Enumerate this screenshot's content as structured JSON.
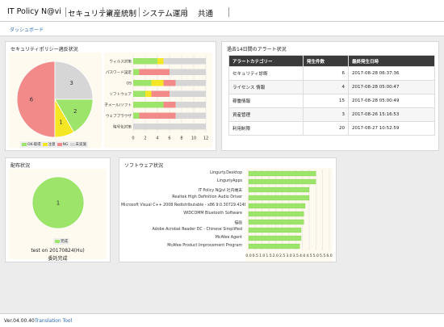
{
  "nav": {
    "items": [
      "IT Policy N@vi",
      "セキュリティ",
      "資産統制",
      "システム運用",
      "共通"
    ]
  },
  "breadcrumb": "ダッシュボード",
  "security_panel": {
    "title": "セキュリティポリシー適反状況",
    "pie_legend": [
      "OK-取得",
      "注意",
      "NG",
      "未実施"
    ]
  },
  "alerts_panel": {
    "title": "過去14日間のアラート状況",
    "columns": [
      "アラートカテゴリー",
      "発生件数",
      "最終発生日時"
    ],
    "rows": [
      [
        "セキュリティ診断",
        "6",
        "2017-08-28 06:37:36"
      ],
      [
        "ライセンス 情報",
        "4",
        "2017-08-28 05:00:47"
      ],
      [
        "稼働情報",
        "15",
        "2017-08-28 05:00:49"
      ],
      [
        "資産管理",
        "3",
        "2017-08-26 15:16:53"
      ],
      [
        "利用制限",
        "20",
        "2017-08-27 10:52:59"
      ]
    ]
  },
  "distribution_panel": {
    "title": "配布状況",
    "legend": "完成",
    "caption_line1": "test on 20170824(Hu)",
    "caption_line2": "委託完成"
  },
  "software_panel": {
    "title": "ソフトウェア状況"
  },
  "colors": {
    "ok_green": "#9de46a",
    "caution_yellow": "#f5e625",
    "ng_red": "#f28a8a",
    "unconducted_gray": "#d6d6d6",
    "link_blue": "#2a6bb5"
  },
  "chart_data": [
    {
      "type": "pie",
      "name": "security-policy-pie",
      "labels": [
        "NG",
        "未実施",
        "OK-取得",
        "注意"
      ],
      "values": [
        6,
        3,
        2,
        1
      ],
      "legend": [
        "OK-取得",
        "注意",
        "NG",
        "未実施"
      ]
    },
    {
      "type": "bar",
      "stacked": true,
      "orientation": "horizontal",
      "categories": [
        "ウィルス対策",
        "パスワード設定",
        "OS",
        "ソフトウェア",
        "電子メール/ソフト",
        "ウェブブラウザ",
        "暗号化対策"
      ],
      "series": [
        {
          "name": "OK-取得",
          "values": [
            4,
            1,
            3,
            2,
            5,
            1,
            0
          ]
        },
        {
          "name": "注意",
          "values": [
            1,
            0,
            2,
            1,
            0,
            0,
            0
          ]
        },
        {
          "name": "NG",
          "values": [
            0,
            5,
            2,
            3,
            2,
            6,
            0
          ]
        },
        {
          "name": "未実施",
          "values": [
            7,
            6,
            5,
            6,
            5,
            5,
            12
          ]
        }
      ],
      "xticks": [
        0,
        2,
        4,
        6,
        8,
        10,
        12
      ],
      "xlim": [
        0,
        12
      ]
    },
    {
      "type": "pie",
      "name": "distribution-pie",
      "labels": [
        "完成"
      ],
      "values": [
        1
      ]
    },
    {
      "type": "bar",
      "orientation": "horizontal",
      "categories": [
        "Lingurly.Desktop",
        "LinguriyApps",
        "IT Policy N@vi 社内端末",
        "Realtek High Definition Audio Driver",
        "Microsoft Visual C++ 2008 Redistributable - x86 9.0.30729.4148",
        "WIDCOMM Bluetooth Software",
        "描画",
        "Adobe Acrobat Reader DC - Chinese Simplified",
        "McAfee Agent",
        "McAfee Product Improvement Program"
      ],
      "values": [
        5,
        5,
        4.5,
        4.5,
        4.2,
        4.1,
        4.1,
        3.9,
        3.9,
        3.8
      ],
      "xticks": [
        "0.0",
        "0.5",
        "1.0",
        "1.5",
        "2.0",
        "2.5",
        "3.0",
        "3.5",
        "4.0",
        "4.5",
        "5.0",
        "5.5",
        "6.0"
      ],
      "xlim": [
        0,
        6
      ]
    }
  ],
  "footer": {
    "version": "Ver.04.00.40",
    "translation_link": "Translation Tool"
  }
}
